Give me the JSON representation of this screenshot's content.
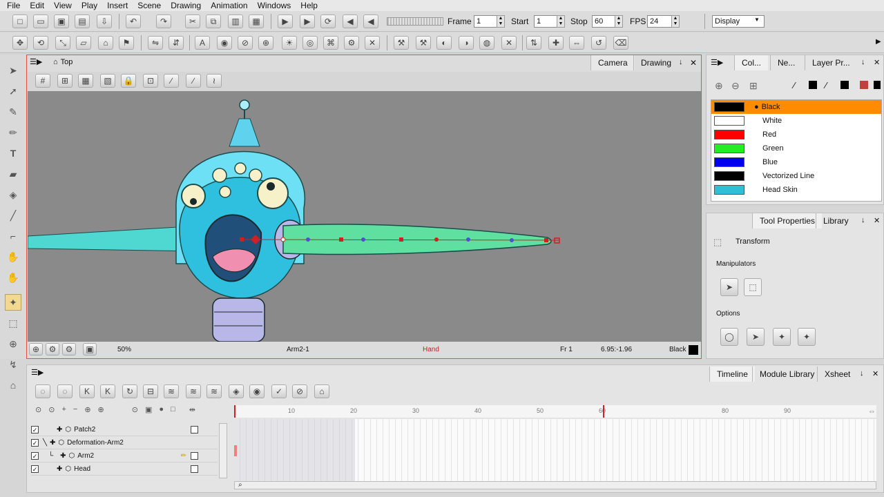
{
  "menu": [
    "File",
    "Edit",
    "View",
    "Play",
    "Insert",
    "Scene",
    "Drawing",
    "Animation",
    "Windows",
    "Help"
  ],
  "playback": {
    "frame_label": "Frame",
    "frame": "1",
    "start_label": "Start",
    "start": "1",
    "stop_label": "Stop",
    "stop": "60",
    "fps_label": "FPS",
    "fps": "24",
    "display": "Display"
  },
  "camera": {
    "view_name": "Top",
    "tabs": [
      "Camera",
      "Drawing"
    ]
  },
  "status": {
    "zoom": "50%",
    "layer": "Arm2-1",
    "tool": "Hand",
    "frame": "Fr 1",
    "coords": "6.95:-1.96",
    "color": "Black"
  },
  "colors_panel": {
    "tabs": [
      "Col...",
      "Ne...",
      "Layer Pr..."
    ],
    "swatches": [
      {
        "name": "Black",
        "color": "#000000",
        "selected": true
      },
      {
        "name": "White",
        "color": "#ffffff"
      },
      {
        "name": "Red",
        "color": "#ff0000"
      },
      {
        "name": "Green",
        "color": "#22ee22"
      },
      {
        "name": "Blue",
        "color": "#0000ee"
      },
      {
        "name": "Vectorized Line",
        "color": "#000000"
      },
      {
        "name": "Head Skin",
        "color": "#2fc0d8"
      }
    ]
  },
  "tool_props": {
    "tabs": [
      "Tool Properties",
      "Library"
    ],
    "tool": "Transform",
    "manipulators": "Manipulators",
    "options": "Options"
  },
  "timeline": {
    "tabs": [
      "Timeline",
      "Module Library",
      "Xsheet"
    ],
    "ruler": [
      "10",
      "20",
      "30",
      "40",
      "50",
      "60",
      "70",
      "80",
      "90"
    ],
    "layers": [
      "Patch2",
      "Deformation-Arm2",
      "Arm2",
      "Head"
    ]
  }
}
